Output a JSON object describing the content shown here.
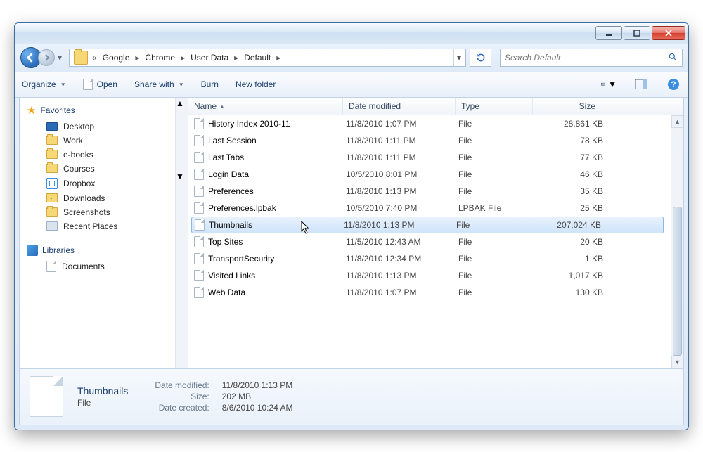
{
  "breadcrumb": {
    "prefix_chevrons": "«",
    "items": [
      "Google",
      "Chrome",
      "User Data",
      "Default"
    ]
  },
  "search": {
    "placeholder": "Search Default"
  },
  "toolbar": {
    "organize": "Organize",
    "open": "Open",
    "share": "Share with",
    "burn": "Burn",
    "newfolder": "New folder"
  },
  "nav": {
    "favorites_label": "Favorites",
    "libraries_label": "Libraries",
    "favorites": [
      {
        "label": "Desktop",
        "icon": "desktop"
      },
      {
        "label": "Work",
        "icon": "folder"
      },
      {
        "label": "e-books",
        "icon": "folder"
      },
      {
        "label": "Courses",
        "icon": "folder"
      },
      {
        "label": "Dropbox",
        "icon": "dropbox"
      },
      {
        "label": "Downloads",
        "icon": "downloads"
      },
      {
        "label": "Screenshots",
        "icon": "folder"
      },
      {
        "label": "Recent Places",
        "icon": "recent"
      }
    ],
    "libraries": [
      {
        "label": "Documents",
        "icon": "doc"
      }
    ]
  },
  "columns": {
    "name": "Name",
    "date": "Date modified",
    "type": "Type",
    "size": "Size"
  },
  "files": [
    {
      "name": "History Index 2010-11",
      "date": "11/8/2010 1:07 PM",
      "type": "File",
      "size": "28,861 KB",
      "selected": false
    },
    {
      "name": "Last Session",
      "date": "11/8/2010 1:11 PM",
      "type": "File",
      "size": "78 KB",
      "selected": false
    },
    {
      "name": "Last Tabs",
      "date": "11/8/2010 1:11 PM",
      "type": "File",
      "size": "77 KB",
      "selected": false
    },
    {
      "name": "Login Data",
      "date": "10/5/2010 8:01 PM",
      "type": "File",
      "size": "46 KB",
      "selected": false
    },
    {
      "name": "Preferences",
      "date": "11/8/2010 1:13 PM",
      "type": "File",
      "size": "35 KB",
      "selected": false
    },
    {
      "name": "Preferences.lpbak",
      "date": "10/5/2010 7:40 PM",
      "type": "LPBAK File",
      "size": "25 KB",
      "selected": false
    },
    {
      "name": "Thumbnails",
      "date": "11/8/2010 1:13 PM",
      "type": "File",
      "size": "207,024 KB",
      "selected": true
    },
    {
      "name": "Top Sites",
      "date": "11/5/2010 12:43 AM",
      "type": "File",
      "size": "20 KB",
      "selected": false
    },
    {
      "name": "TransportSecurity",
      "date": "11/8/2010 12:34 PM",
      "type": "File",
      "size": "1 KB",
      "selected": false
    },
    {
      "name": "Visited Links",
      "date": "11/8/2010 1:13 PM",
      "type": "File",
      "size": "1,017 KB",
      "selected": false
    },
    {
      "name": "Web Data",
      "date": "11/8/2010 1:07 PM",
      "type": "File",
      "size": "130 KB",
      "selected": false
    }
  ],
  "details": {
    "name": "Thumbnails",
    "type": "File",
    "date_modified_label": "Date modified:",
    "date_modified": "11/8/2010 1:13 PM",
    "size_label": "Size:",
    "size": "202 MB",
    "date_created_label": "Date created:",
    "date_created": "8/6/2010 10:24 AM"
  }
}
